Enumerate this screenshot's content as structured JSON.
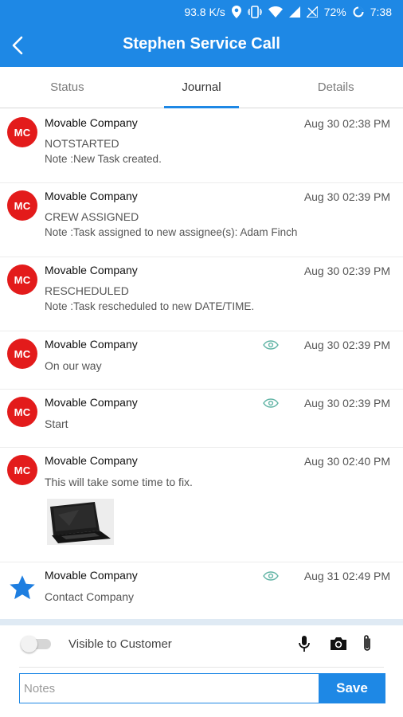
{
  "status_bar": {
    "network_speed": "93.8 K/s",
    "battery": "72%",
    "time": "7:38"
  },
  "app_bar": {
    "title": "Stephen Service Call"
  },
  "tabs": [
    {
      "label": "Status",
      "active": false
    },
    {
      "label": "Journal",
      "active": true
    },
    {
      "label": "Details",
      "active": false
    }
  ],
  "entries": [
    {
      "avatar": "MC",
      "company": "Movable Company",
      "time": "Aug 30 02:38 PM",
      "status": "NOTSTARTED",
      "note": "Note :New Task created."
    },
    {
      "avatar": "MC",
      "company": "Movable Company",
      "time": "Aug 30 02:39 PM",
      "status": "CREW ASSIGNED",
      "note": "Note :Task assigned to new assignee(s): Adam Finch"
    },
    {
      "avatar": "MC",
      "company": "Movable Company",
      "time": "Aug 30 02:39 PM",
      "status": "RESCHEDULED",
      "note": "Note :Task rescheduled to new DATE/TIME."
    },
    {
      "avatar": "MC",
      "company": "Movable Company",
      "time": "Aug 30 02:39 PM",
      "message": "On our way",
      "visible_to_customer": true
    },
    {
      "avatar": "MC",
      "company": "Movable Company",
      "time": "Aug 30 02:39 PM",
      "message": "Start",
      "visible_to_customer": true
    },
    {
      "avatar": "MC",
      "company": "Movable Company",
      "time": "Aug 30 02:40 PM",
      "message": "This will take some time to fix.",
      "has_photo": true
    },
    {
      "avatar_icon": "star-icon",
      "company": "Movable Company",
      "time": "Aug 31 02:49 PM",
      "message": "Contact Company",
      "visible_to_customer": true
    }
  ],
  "compose": {
    "visible_to_customer_label": "Visible to Customer",
    "visible_to_customer_on": false,
    "notes_placeholder": "Notes",
    "save_label": "Save"
  },
  "colors": {
    "primary": "#1e88e5",
    "avatar": "#e31b1b",
    "visible_eye": "#5fb3a4"
  }
}
